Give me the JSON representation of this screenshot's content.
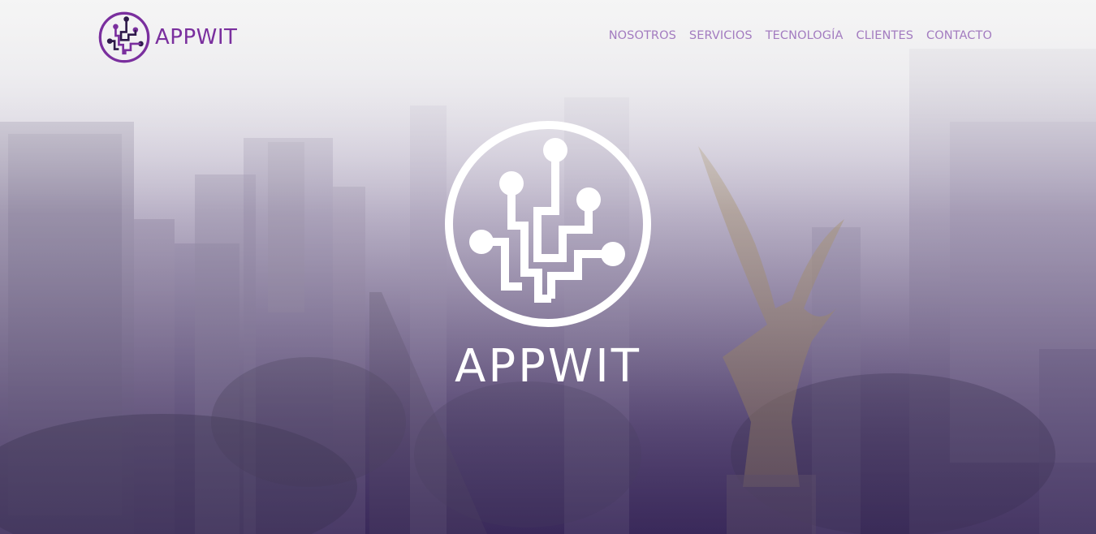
{
  "brand": {
    "name": "APPWIT",
    "logo_icon": "circuit-tree-logo",
    "accent_color": "#7a2f9e"
  },
  "nav": {
    "items": [
      {
        "label": "NOSOTROS"
      },
      {
        "label": "SERVICIOS"
      },
      {
        "label": "TECNOLOGÍA"
      },
      {
        "label": "CLIENTES"
      },
      {
        "label": "CONTACTO"
      }
    ],
    "color": "#a37cc0"
  },
  "hero": {
    "title": "APPWIT",
    "logo_icon": "circuit-tree-logo",
    "background": "city-avenue-with-angel-monument-photo"
  }
}
